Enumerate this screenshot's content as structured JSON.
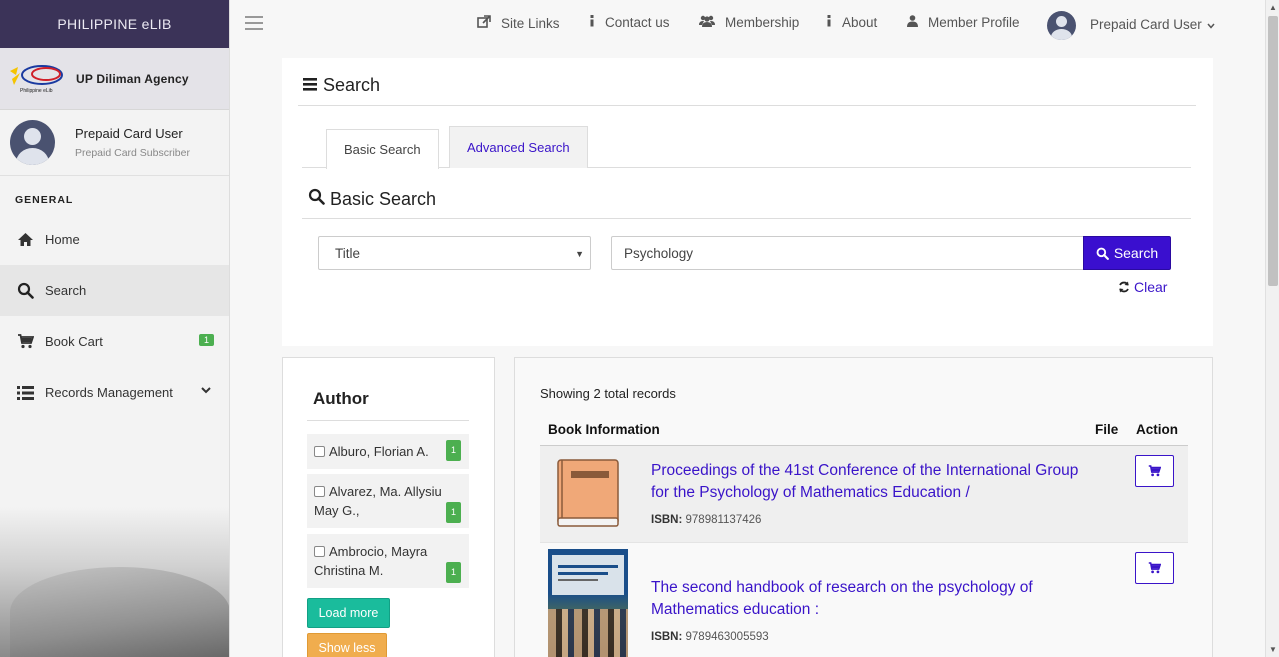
{
  "sidebar": {
    "brand": "PHILIPPINE eLIB",
    "agency": "UP Diliman Agency",
    "agency_logo_text": "Philippine eLib",
    "user": {
      "name": "Prepaid Card User",
      "role": "Prepaid Card Subscriber"
    },
    "section_label": "GENERAL",
    "items": [
      {
        "label": "Home",
        "icon": "home-icon"
      },
      {
        "label": "Search",
        "icon": "search-icon"
      },
      {
        "label": "Book Cart",
        "icon": "cart-icon",
        "badge": "1"
      },
      {
        "label": "Records Management",
        "icon": "list-icon"
      }
    ]
  },
  "topbar": {
    "links": [
      {
        "label": "Site Links",
        "icon": "external-link-icon"
      },
      {
        "label": "Contact us",
        "icon": "info-icon"
      },
      {
        "label": "Membership",
        "icon": "users-icon"
      },
      {
        "label": "About",
        "icon": "info-icon"
      },
      {
        "label": "Member Profile",
        "icon": "user-icon"
      }
    ],
    "user_menu": "Prepaid Card User"
  },
  "search": {
    "title": "Search",
    "tabs": {
      "basic": "Basic Search",
      "advanced": "Advanced Search"
    },
    "subtitle": "Basic Search",
    "field_selected": "Title",
    "query": "Psychology",
    "button": "Search",
    "clear": "Clear"
  },
  "filters": {
    "title": "Author",
    "authors": [
      {
        "name": "Alburo, Florian A.",
        "count": "1"
      },
      {
        "name": "Alvarez, Ma. Allysiu May G.,",
        "count": "1"
      },
      {
        "name": "Ambrocio, Mayra Christina M.",
        "count": "1"
      }
    ],
    "load_more": "Load more",
    "show_less": "Show less"
  },
  "results": {
    "summary": "Showing 2 total records",
    "headers": {
      "info": "Book Information",
      "file": "File",
      "action": "Action"
    },
    "isbn_label": "ISBN:",
    "records": [
      {
        "title": "Proceedings of the 41st Conference of the International Group for the Psychology of Mathematics Education /",
        "isbn": "978981137426"
      },
      {
        "title": "The second handbook of research on the psychology of Mathematics education :",
        "isbn": "9789463005593"
      }
    ]
  },
  "colors": {
    "brand": "#3b3358",
    "accent": "#3a0fcf",
    "link": "#3a14c9",
    "badge": "#4caf50",
    "load_more": "#1abc9c",
    "show_less": "#f0ad4e"
  }
}
